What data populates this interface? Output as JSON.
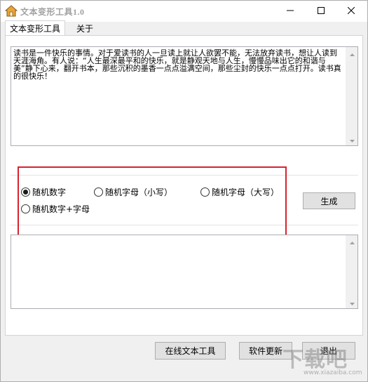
{
  "window": {
    "title": "文本变形工具1.0"
  },
  "tabs": [
    {
      "label": "文本变形工具",
      "active": true
    },
    {
      "label": "关于",
      "active": false
    }
  ],
  "input": {
    "text": "读书是一件快乐的事情。对于爱读书的人一旦读上就让人欲罢不能，无法放弃读书，想让人读到天涯海角。有人说：“人生最深最平和的快乐，就是静观天地与人生，慢慢品味出它的和谐与美”静下心来，翻开书本，那些沉积的墨香一点点溢满空间，那些尘封的快乐一点点打开。读书真的很快乐！"
  },
  "options": {
    "items": [
      {
        "label": "随机数字",
        "checked": true
      },
      {
        "label": "随机字母（小写）",
        "checked": false
      },
      {
        "label": "随机字母（大写）",
        "checked": false
      },
      {
        "label": "随机数字+字母",
        "checked": false
      }
    ],
    "generate_label": "生成"
  },
  "output": {
    "text": ""
  },
  "footer": {
    "online_label": "在线文本工具",
    "update_label": "软件更新",
    "exit_label": "退出"
  },
  "watermark": {
    "text": "下载吧",
    "sub": "www.xiazaiba.com"
  },
  "colors": {
    "highlight": "#d7232f",
    "title_text": "#a0a0a0"
  },
  "icons": [
    "app-icon",
    "minimize-icon",
    "maximize-icon",
    "close-icon",
    "scroll-up-icon",
    "scroll-down-icon"
  ]
}
